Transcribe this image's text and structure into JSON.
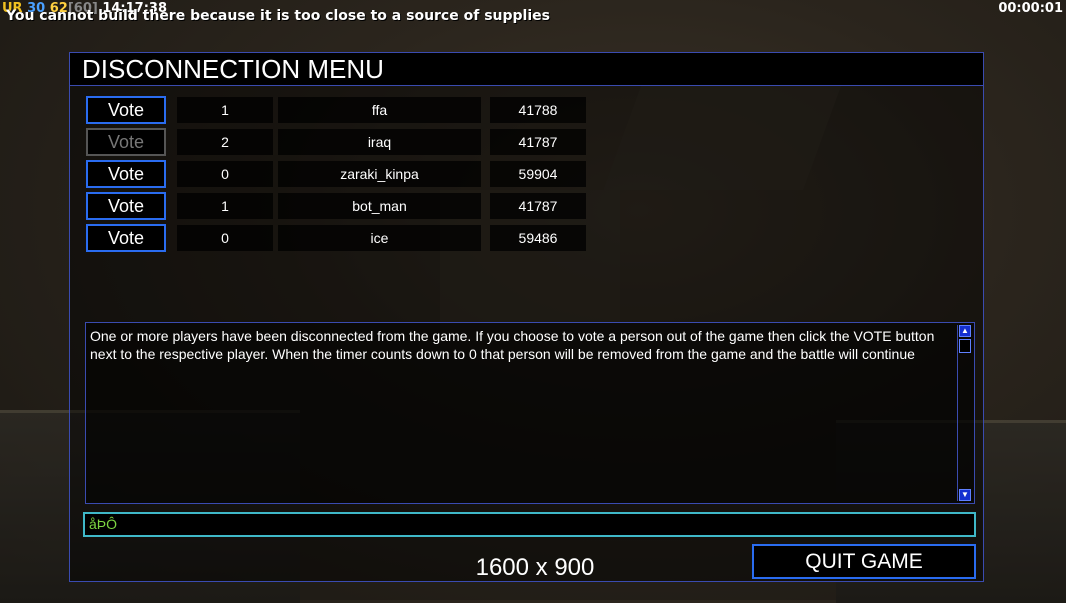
{
  "hud": {
    "stat_ur": "UR",
    "stat_a": "30",
    "stat_b": "62",
    "stat_c": "[60]",
    "clock": "14:17:38",
    "message": "You cannot build there because it is too close to a source of supplies",
    "timer": "00:00:01"
  },
  "menu": {
    "title": "DISCONNECTION MENU",
    "players": [
      {
        "vote_label": "Vote",
        "vote_enabled": true,
        "votes": "1",
        "name": "ffa",
        "ping": "41788"
      },
      {
        "vote_label": "Vote",
        "vote_enabled": false,
        "votes": "2",
        "name": "iraq",
        "ping": "41787"
      },
      {
        "vote_label": "Vote",
        "vote_enabled": true,
        "votes": "0",
        "name": "zaraki_kinpa",
        "ping": "59904"
      },
      {
        "vote_label": "Vote",
        "vote_enabled": true,
        "votes": "1",
        "name": "bot_man",
        "ping": "41787"
      },
      {
        "vote_label": "Vote",
        "vote_enabled": true,
        "votes": "0",
        "name": "ice",
        "ping": "59486"
      }
    ],
    "message": "One or more players have been disconnected from the game. If you choose to vote a person out of the game then click the VOTE button next to the respective player. When the timer counts down to 0 that person will be removed from the game and the battle will continue",
    "chat_value": "åÞÔ",
    "resolution": "1600 x 900",
    "quit_label": "QUIT GAME"
  },
  "colors": {
    "panel_border": "#3a4bb0",
    "button_border": "#2a6cf0",
    "chat_border": "#3fb8c8",
    "chat_text": "#7dd642"
  }
}
